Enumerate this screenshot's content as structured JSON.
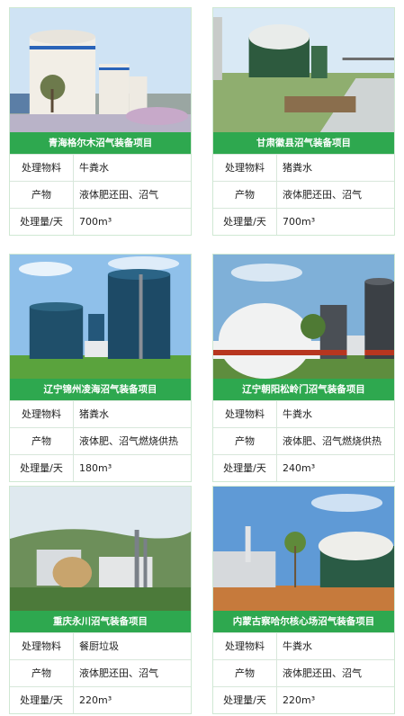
{
  "projects": [
    {
      "title": "青海格尔木沼气装备项目",
      "rows": [
        {
          "label": "处理物料",
          "value": "牛粪水"
        },
        {
          "label": "产物",
          "value": "液体肥还田、沼气"
        },
        {
          "label": "处理量/天",
          "value": "700m³"
        }
      ]
    },
    {
      "title": "甘肃徽县沼气装备项目",
      "rows": [
        {
          "label": "处理物料",
          "value": "猪粪水"
        },
        {
          "label": "产物",
          "value": "液体肥还田、沼气"
        },
        {
          "label": "处理量/天",
          "value": "700m³"
        }
      ]
    },
    {
      "title": "辽宁锦州凌海沼气装备项目",
      "rows": [
        {
          "label": "处理物料",
          "value": "猪粪水"
        },
        {
          "label": "产物",
          "value": "液体肥、沼气燃烧供热"
        },
        {
          "label": "处理量/天",
          "value": "180m³"
        }
      ]
    },
    {
      "title": "辽宁朝阳松岭门沼气装备项目",
      "rows": [
        {
          "label": "处理物料",
          "value": "牛粪水"
        },
        {
          "label": "产物",
          "value": "液体肥、沼气燃烧供热"
        },
        {
          "label": "处理量/天",
          "value": "240m³"
        }
      ]
    },
    {
      "title": "重庆永川沼气装备项目",
      "rows": [
        {
          "label": "处理物料",
          "value": "餐厨垃圾"
        },
        {
          "label": "产物",
          "value": "液体肥还田、沼气"
        },
        {
          "label": "处理量/天",
          "value": "220m³"
        }
      ]
    },
    {
      "title": "内蒙古察哈尔核心场沼气装备项目",
      "rows": [
        {
          "label": "处理物料",
          "value": "牛粪水"
        },
        {
          "label": "产物",
          "value": "液体肥还田、沼气"
        },
        {
          "label": "处理量/天",
          "value": "220m³"
        }
      ]
    }
  ],
  "colors": {
    "accent": "#2ea84f",
    "border": "#cfe8d3"
  }
}
